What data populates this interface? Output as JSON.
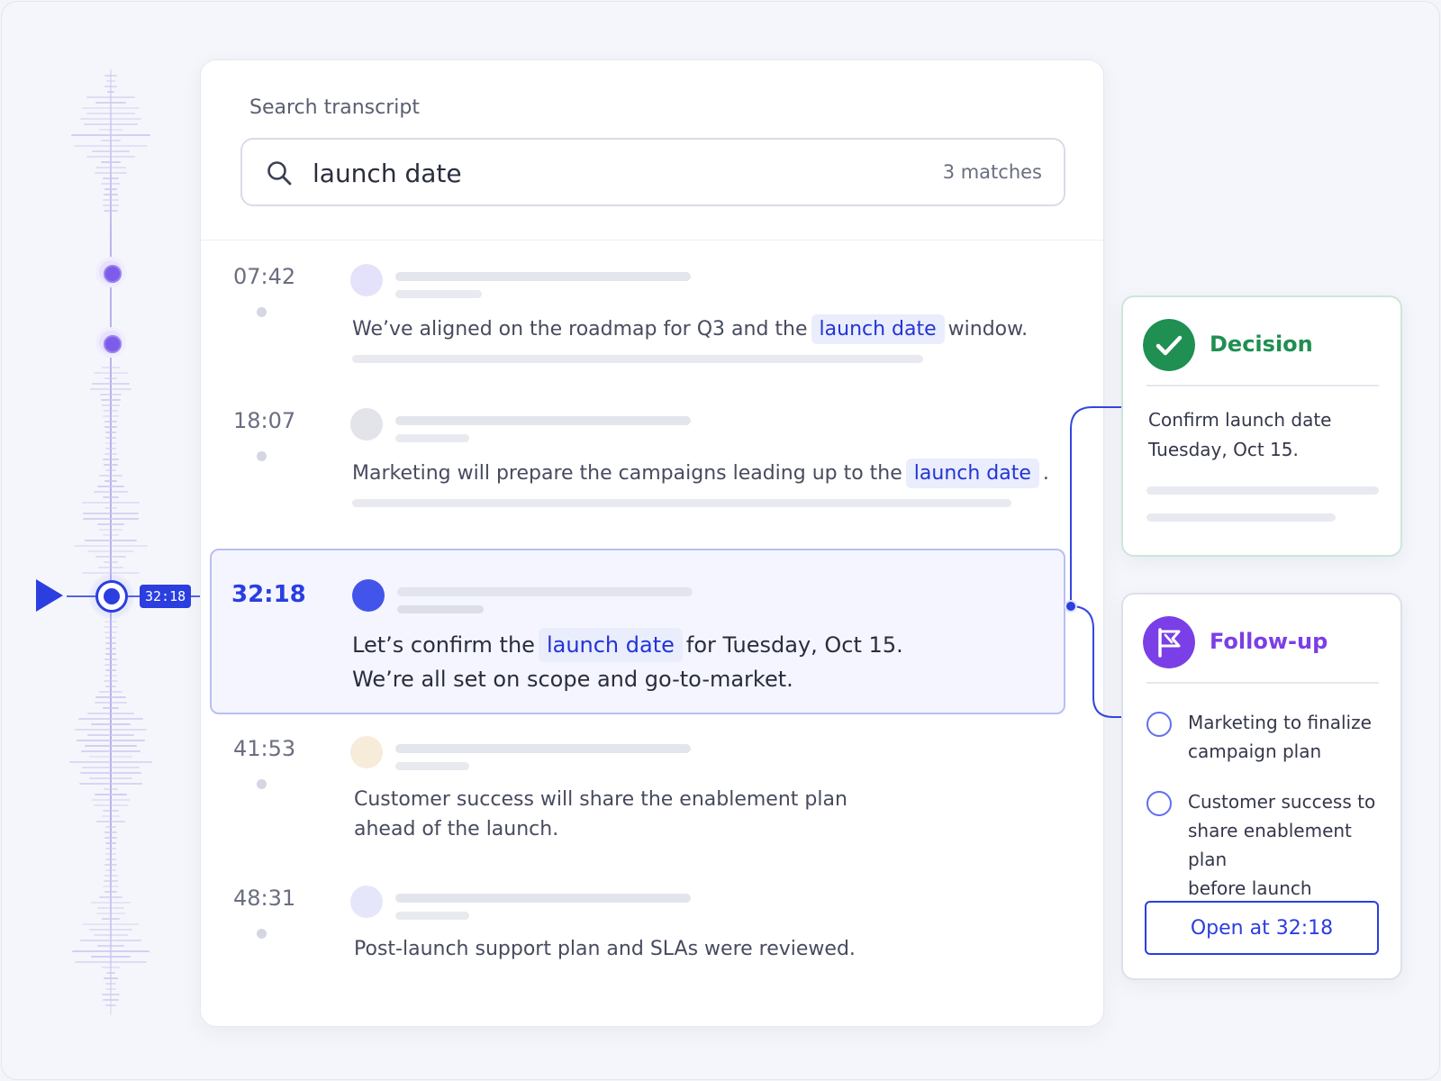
{
  "timeline": {
    "current_time": "32:18",
    "marker_count": 2
  },
  "search": {
    "label": "Search transcript",
    "query": "launch date",
    "match_count": "3 matches"
  },
  "entries": [
    {
      "time": "07:42",
      "before": "We’ve aligned on the roadmap for Q3 and the",
      "highlight": "launch date",
      "after": "window.",
      "avatar_color": "#e4e2fb"
    },
    {
      "time": "18:07",
      "before": "Marketing will prepare the campaigns leading up to the",
      "highlight": "launch date",
      "after": ".",
      "avatar_color": "#e2e4ea"
    },
    {
      "time": "32:18",
      "before": "Let’s confirm the",
      "highlight": "launch date",
      "after": "for Tuesday, Oct 15.",
      "line2": "We’re all set on scope and go-to-market.",
      "avatar_color": "#4354ea",
      "active": true
    },
    {
      "time": "41:53",
      "line1": "Customer success will share the enablement plan",
      "line2": "ahead of the launch.",
      "avatar_color": "#f7ecd9"
    },
    {
      "time": "48:31",
      "line1": "Post-launch support plan and SLAs were reviewed.",
      "avatar_color": "#e6e6fb"
    }
  ],
  "decision": {
    "title": "Decision",
    "line1": "Confirm launch date",
    "line2": "Tuesday, Oct 15.",
    "color": "#1f8f52"
  },
  "followup": {
    "title": "Follow-up",
    "items": [
      {
        "lines": [
          "Marketing to finalize",
          "campaign plan"
        ]
      },
      {
        "lines": [
          "Customer success to",
          "share enablement plan",
          "before launch"
        ]
      }
    ],
    "button_label": "Open at 32:18",
    "color": "#7a3fe6"
  },
  "colors": {
    "accent": "#2b3ee0",
    "highlight_bg": "#eaedfc",
    "rail": "#b9b0ee"
  },
  "icons": [
    "play-icon",
    "search-icon",
    "check-icon",
    "flag-icon"
  ]
}
